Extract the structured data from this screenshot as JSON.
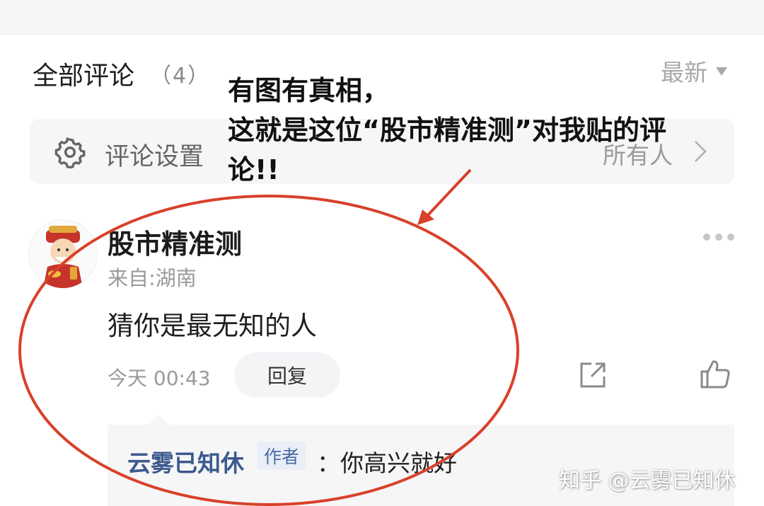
{
  "header": {
    "title": "全部评论",
    "count": "（4）",
    "sort_label": "最新"
  },
  "settings": {
    "label": "评论设置",
    "value": "所有人"
  },
  "comment": {
    "username": "股市精准测",
    "location": "来自:湖南",
    "text": "猜你是最无知的人",
    "time": "今天 00:43",
    "reply_label": "回复"
  },
  "sub_reply": {
    "name": "云雾已知休",
    "badge": "作者",
    "text": "：你高兴就好"
  },
  "annotation": {
    "line1": "有图有真相，",
    "line2": "这就是这位“股市精准测”对我贴的评",
    "line3": "论!!"
  },
  "watermark": "知乎 @云雾已知休",
  "colors": {
    "annotation_red": "#d8412a",
    "link_blue": "#3d5a8e"
  },
  "icons": [
    "gear-icon",
    "chevron-right-icon",
    "more-icon",
    "share-icon",
    "like-icon",
    "caret-down-icon"
  ]
}
